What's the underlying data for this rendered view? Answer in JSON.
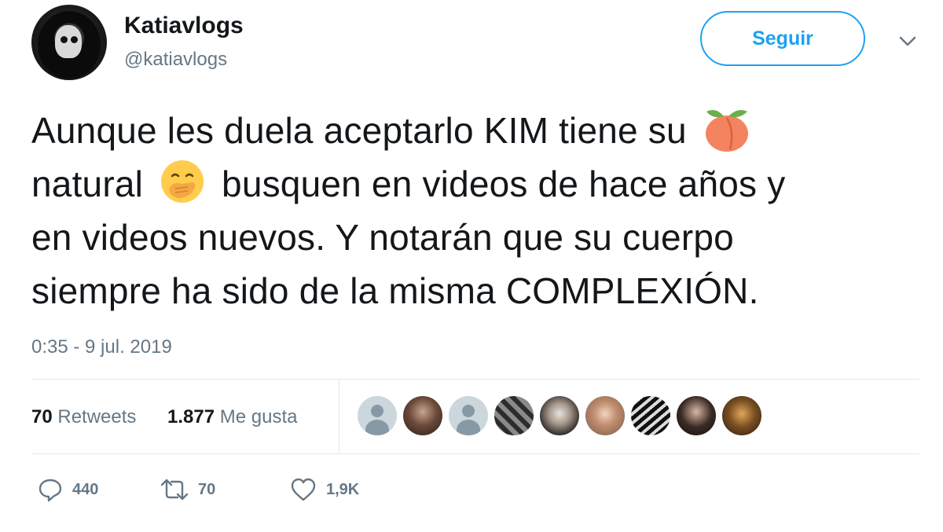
{
  "user": {
    "display_name": "Katiavlogs",
    "handle": "@katiavlogs"
  },
  "follow_button": {
    "label": "Seguir"
  },
  "tweet": {
    "lines": [
      "Aunque les duela aceptarlo KIM tiene su",
      "natural",
      "busquen en videos de hace años y",
      "en videos nuevos. Y notarán que su cuerpo",
      "siempre ha sido de la misma COMPLEXIÓN."
    ],
    "emojis": [
      "peach-emoji",
      "hand-over-mouth-emoji"
    ],
    "timestamp": "0:35 - 9 jul. 2019"
  },
  "stats": {
    "retweets_count": "70",
    "retweets_label": "Retweets",
    "likes_count": "1.877",
    "likes_label": "Me gusta"
  },
  "actions": {
    "reply_count": "440",
    "retweet_count": "70",
    "like_count": "1,9K"
  },
  "colors": {
    "accent": "#1da1f2",
    "secondary_text": "#657786",
    "primary_text": "#14171a"
  }
}
